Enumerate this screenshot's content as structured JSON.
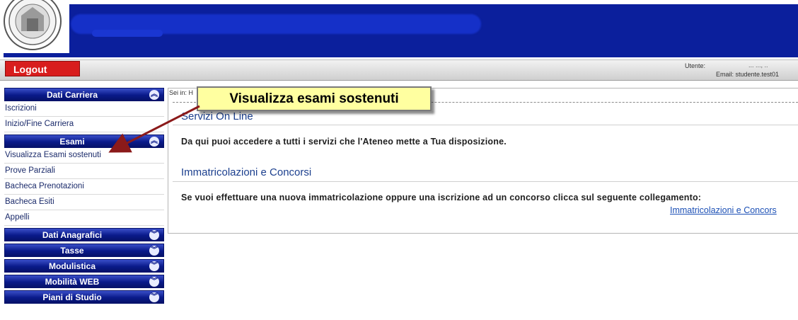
{
  "header": {
    "user_label": "Utente:",
    "user_value": "... ..., ..",
    "email": "Email: studente.test01"
  },
  "topbar": {
    "logout_label": "Logout"
  },
  "sidebar": {
    "sections": [
      {
        "label": "Dati Carriera",
        "expanded": true,
        "items": [
          "Iscrizioni",
          "Inizio/Fine Carriera"
        ]
      },
      {
        "label": "Esami",
        "expanded": true,
        "items": [
          "Visualizza Esami sostenuti",
          "Prove Parziali",
          "Bacheca Prenotazioni",
          "Bacheca Esiti",
          "Appelli"
        ]
      },
      {
        "label": "Dati Anagrafici",
        "expanded": false,
        "items": []
      },
      {
        "label": "Tasse",
        "expanded": false,
        "items": []
      },
      {
        "label": "Modulistica",
        "expanded": false,
        "items": []
      },
      {
        "label": "Mobilità WEB",
        "expanded": false,
        "items": []
      },
      {
        "label": "Piani di Studio",
        "expanded": false,
        "items": []
      }
    ]
  },
  "main": {
    "breadcrumb": "Sei in: H",
    "heading_services": "Servizi On Line",
    "intro": "Da qui puoi accedere a tutti i servizi che l'Ateneo mette a Tua disposizione.",
    "heading_imm": "Immatricolazioni e Concorsi",
    "imm_text": "Se vuoi effettuare una nuova immatricolazione oppure una iscrizione ad un concorso clicca sul seguente collegamento:",
    "imm_link": "Immatricolazioni e Concors"
  },
  "callout": {
    "text": "Visualizza esami sostenuti"
  },
  "colors": {
    "banner": "#0b1f9c",
    "logout": "#d81d1d",
    "heading": "#1b3f8e",
    "callout_bg": "#ffffa0",
    "arrow": "#8b1a1a"
  },
  "icons": {
    "expanded": "chevron-up-icon",
    "collapsed": "chevron-down-icon",
    "logo": "university-seal-logo"
  }
}
